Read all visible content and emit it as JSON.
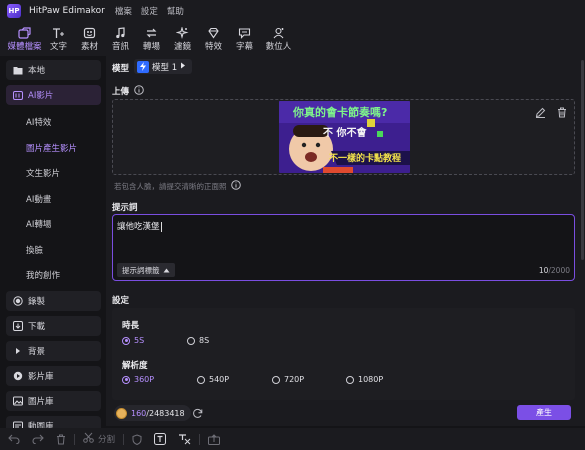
{
  "app": {
    "title": "HitPaw Edimakor",
    "logo_text": "HP"
  },
  "menu": [
    "檔案",
    "設定",
    "幫助"
  ],
  "toolbar": [
    {
      "label": "媒體檔案",
      "icon": "media-icon",
      "active": true
    },
    {
      "label": "文字",
      "icon": "text-icon"
    },
    {
      "label": "素材",
      "icon": "materials-icon"
    },
    {
      "label": "音訊",
      "icon": "audio-icon"
    },
    {
      "label": "轉場",
      "icon": "transition-icon"
    },
    {
      "label": "濾鏡",
      "icon": "filter-icon"
    },
    {
      "label": "特效",
      "icon": "effects-icon"
    },
    {
      "label": "字幕",
      "icon": "subtitle-icon"
    },
    {
      "label": "數位人",
      "icon": "digital-human-icon"
    }
  ],
  "sidebar": {
    "local": "本地",
    "ai_video": "AI影片",
    "sub_items": [
      "AI特效",
      "圖片產生影片",
      "文生影片",
      "AI動畫",
      "AI轉場",
      "換臉",
      "我的創作"
    ],
    "active_sub": 1,
    "bottom_items": [
      "錄製",
      "下載",
      "背景",
      "影片庫",
      "圖片庫",
      "動圖庫"
    ]
  },
  "main": {
    "model_label": "模型",
    "model_value": "模型 1",
    "upload_label": "上傳",
    "thumb_text_top": "你真的會卡節奏嗎?",
    "thumb_text_mid": "不 你不會",
    "thumb_text_bottom": "不一樣的卡點教程",
    "hint": "若包含人臉，請提交清晰的正面照",
    "prompt_label": "提示詞",
    "prompt_value": "讓他吃漢堡",
    "prompt_tag_button": "提示詞標籤",
    "char_count": "10",
    "char_max": "/2000",
    "settings_label": "設定",
    "duration_label": "時長",
    "duration_options": [
      "5S",
      "8S"
    ],
    "duration_selected": 0,
    "resolution_label": "解析度",
    "resolution_options": [
      "360P",
      "540P",
      "720P",
      "1080P"
    ],
    "resolution_selected": 0,
    "credits_used": "160",
    "credits_total": "/2483418",
    "generate_button": "產生"
  },
  "bottombar": {
    "split_label": "分割"
  },
  "colors": {
    "accent": "#b690ff",
    "button": "#7b4fe6",
    "background": "#141417",
    "panel": "#1b1b1f"
  }
}
